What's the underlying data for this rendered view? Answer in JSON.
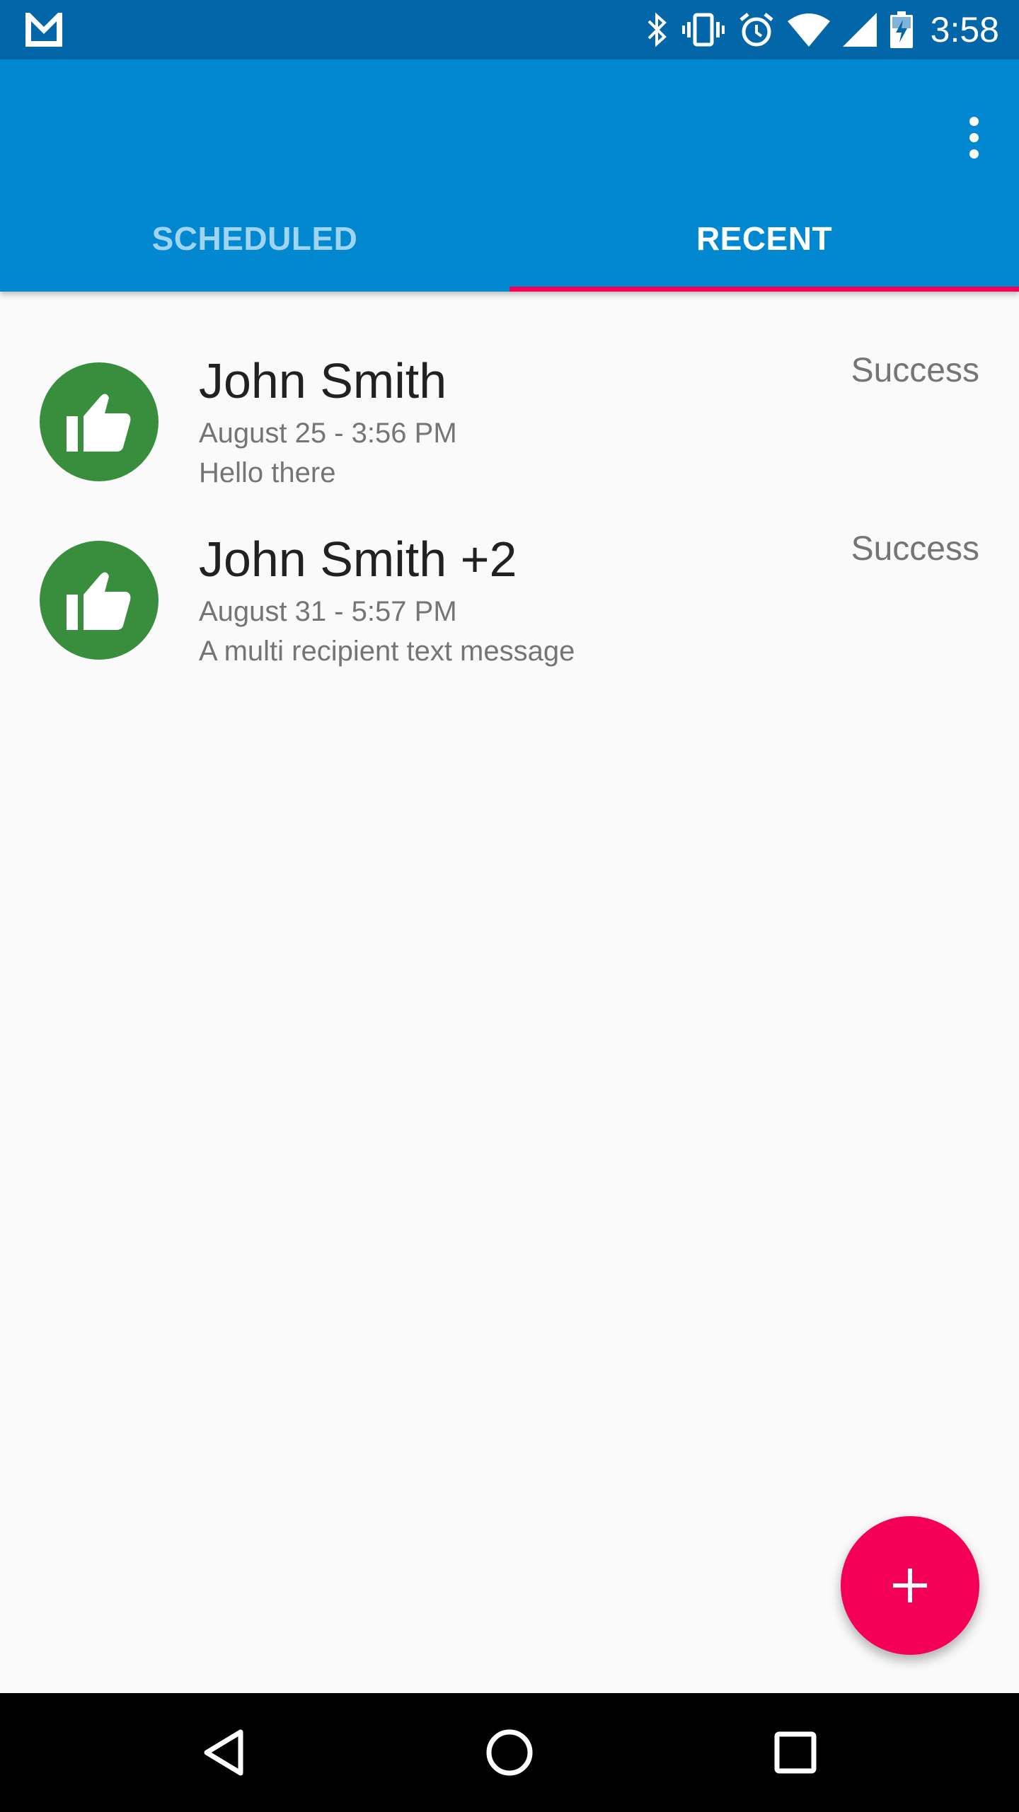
{
  "status_bar": {
    "time": "3:58",
    "icons": [
      "gmail-icon",
      "bluetooth-icon",
      "vibrate-icon",
      "alarm-icon",
      "wifi-icon",
      "signal-icon",
      "battery-charging-icon"
    ]
  },
  "app_bar": {
    "menu_icon": "more-vert-icon",
    "tabs": [
      {
        "label": "SCHEDULED",
        "active": false
      },
      {
        "label": "RECENT",
        "active": true
      }
    ]
  },
  "messages": [
    {
      "icon": "thumbs-up-icon",
      "recipient": "John Smith",
      "date": "August 25 - 3:56 PM",
      "message": "Hello there",
      "status": "Success"
    },
    {
      "icon": "thumbs-up-icon",
      "recipient": "John Smith +2",
      "date": "August 31 - 5:57 PM",
      "message": "A multi recipient text message",
      "status": "Success"
    }
  ],
  "fab": {
    "icon": "plus-icon"
  },
  "nav_bar": {
    "buttons": [
      "back-icon",
      "home-icon",
      "recents-icon"
    ]
  },
  "colors": {
    "status_bar": "#0266a8",
    "app_bar": "#0288d1",
    "tab_indicator": "#f50057",
    "avatar": "#388e3c",
    "fab": "#f50057"
  }
}
